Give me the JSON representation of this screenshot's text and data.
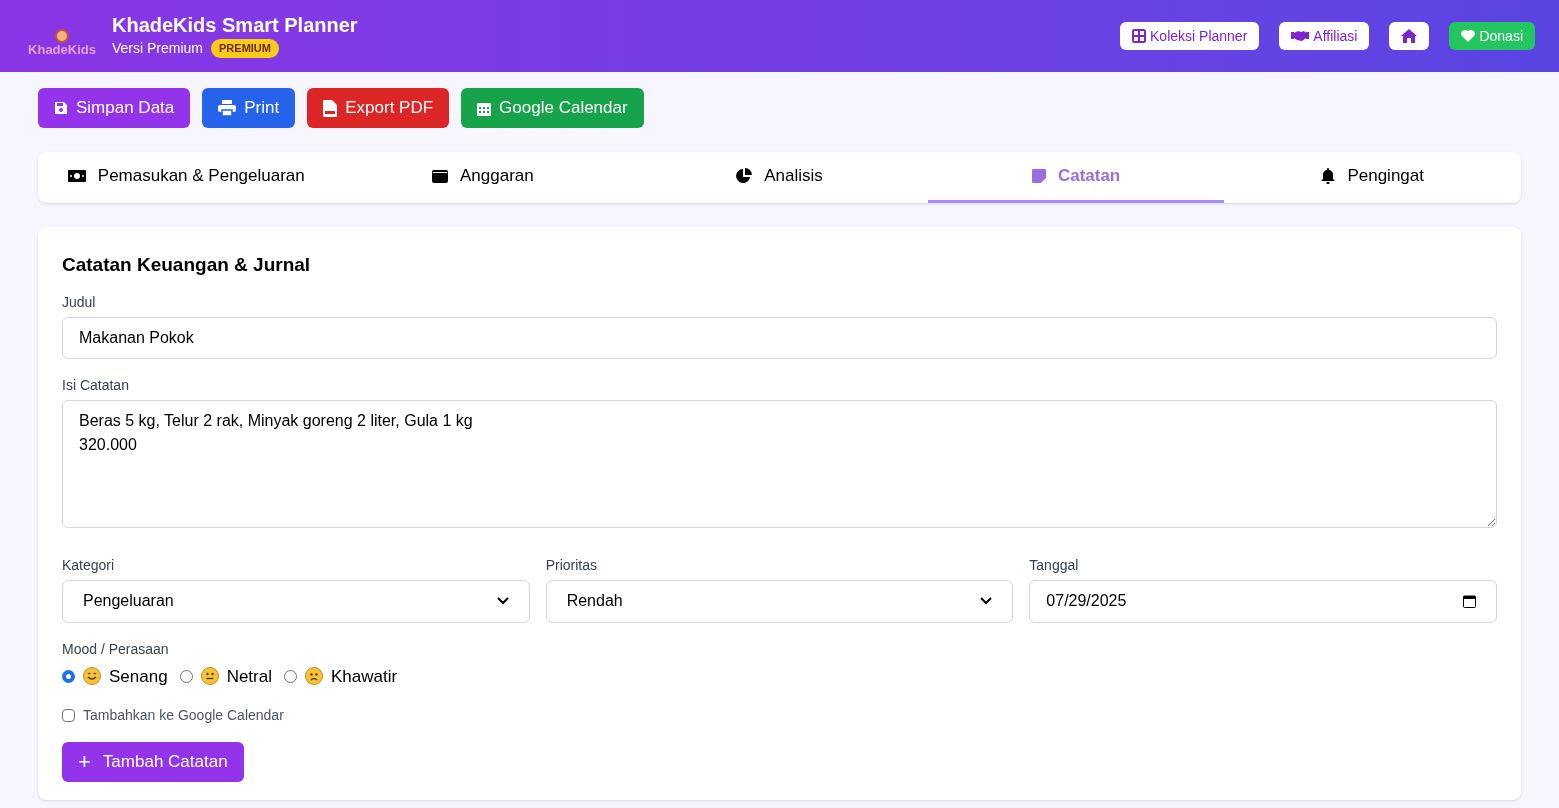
{
  "header": {
    "logo_text": "KhadeKids",
    "title": "KhadeKids Smart Planner",
    "subtitle": "Versi Premium",
    "badge": "PREMIUM",
    "links": [
      {
        "label": "Koleksi Planner",
        "kind": "grid"
      },
      {
        "label": "Affiliasi",
        "kind": "handshake"
      },
      {
        "kind": "home"
      },
      {
        "label": "Donasi",
        "kind": "heart"
      }
    ]
  },
  "actions": [
    {
      "label": "Simpan Data",
      "color": "#9333ea"
    },
    {
      "label": "Print",
      "color": "#2563eb"
    },
    {
      "label": "Export PDF",
      "color": "#dc2626"
    },
    {
      "label": "Google Calendar",
      "color": "#16a34a"
    }
  ],
  "tabs": [
    {
      "label": "Pemasukan & Pengeluaran",
      "selected": false
    },
    {
      "label": "Anggaran",
      "selected": false
    },
    {
      "label": "Analisis",
      "selected": false
    },
    {
      "label": "Catatan",
      "selected": true
    },
    {
      "label": "Pengingat",
      "selected": false
    }
  ],
  "form": {
    "title": "Catatan Keuangan & Jurnal",
    "judul": {
      "label": "Judul",
      "value": "Makanan Pokok"
    },
    "isi": {
      "label": "Isi Catatan",
      "value": "Beras 5 kg, Telur 2 rak, Minyak goreng 2 liter, Gula 1 kg\n320.000"
    },
    "selects": [
      {
        "label": "Kategori",
        "value": "Pengeluaran",
        "kind": "select"
      },
      {
        "label": "Prioritas",
        "value": "Rendah",
        "kind": "select"
      },
      {
        "label": "Tanggal",
        "value": "07/29/2025",
        "kind": "date"
      }
    ],
    "mood": {
      "label": "Mood / Perasaan",
      "options": [
        {
          "label": "Senang",
          "selected": true
        },
        {
          "label": "Netral",
          "selected": false
        },
        {
          "label": "Khawatir",
          "selected": false
        }
      ]
    },
    "calendar_checkbox": {
      "label": "Tambahkan ke Google Calendar",
      "checked": false
    },
    "submit": {
      "icon": "+",
      "label": "Tambah Catatan"
    }
  }
}
